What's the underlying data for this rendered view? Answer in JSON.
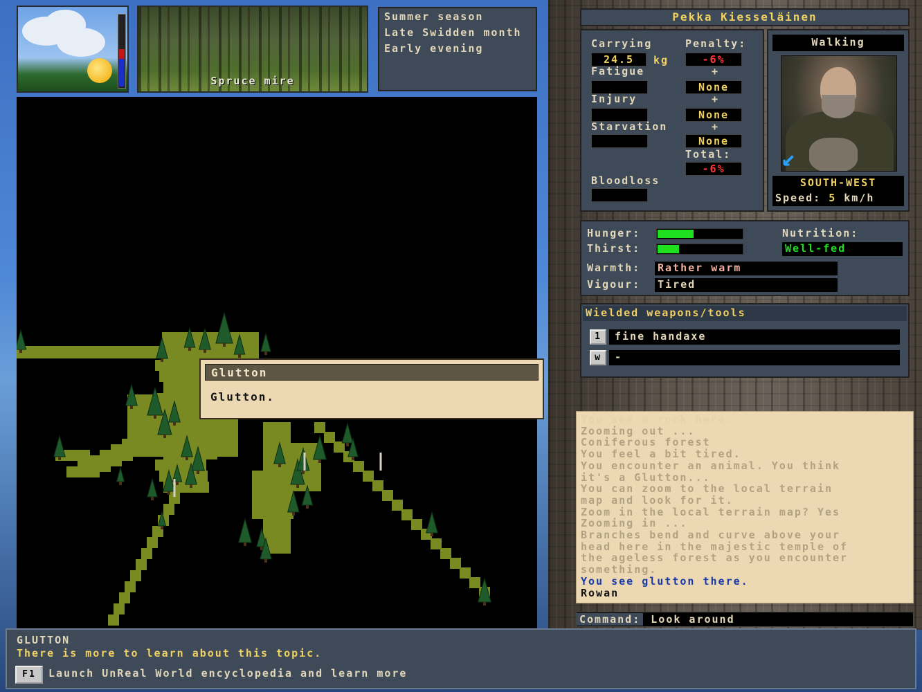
{
  "top": {
    "location_caption": "Spruce mire",
    "season": "Summer season",
    "month": "Late Swidden month",
    "time_of_day": "Early evening"
  },
  "popup": {
    "title": "Glutton",
    "body": "Glutton."
  },
  "character": {
    "name": "Pekka Kiesseläinen",
    "carrying_label": "Carrying",
    "carrying_value": "24.5",
    "carrying_unit": "kg",
    "penalty_label": "Penalty:",
    "penalty_value": "-6%",
    "fatigue_label": "Fatigue",
    "fatigue_penalty": "None",
    "injury_label": "Injury",
    "injury_penalty": "None",
    "starvation_label": "Starvation",
    "starvation_penalty": "None",
    "total_label": "Total:",
    "total_value": "-6%",
    "bloodloss_label": "Bloodloss",
    "plus": "+",
    "movement_mode": "Walking",
    "direction": "SOUTH-WEST",
    "speed_label": "Speed:",
    "speed_value": "5",
    "speed_unit": "km/h"
  },
  "needs": {
    "hunger_label": "Hunger:",
    "hunger_level": 0.42,
    "thirst_label": "Thirst:",
    "thirst_level": 0.25,
    "nutrition_label": "Nutrition:",
    "nutrition_value": "Well-fed",
    "warmth_label": "Warmth:",
    "warmth_value": "Rather warm",
    "vigour_label": "Vigour:",
    "vigour_value": "Tired"
  },
  "weapons": {
    "title": "Wielded weapons/tools",
    "slots": [
      {
        "key": "1",
        "item": "fine handaxe"
      },
      {
        "key": "w",
        "item": "-"
      }
    ]
  },
  "log": {
    "lines": [
      {
        "text": "You see a rock here.",
        "tone": "faint"
      },
      {
        "text": "Zooming out ...",
        "tone": "mid"
      },
      {
        "text": "Coniferous forest",
        "tone": "mid"
      },
      {
        "text": "You feel a bit tired.",
        "tone": "mid"
      },
      {
        "text": "You encounter an animal. You think",
        "tone": "mid"
      },
      {
        "text": "it's a Glutton...",
        "tone": "mid"
      },
      {
        "text": "You can zoom to the local terrain",
        "tone": "mid"
      },
      {
        "text": "map and look for it.",
        "tone": "mid"
      },
      {
        "text": "Zoom in the local terrain map? Yes",
        "tone": "mid"
      },
      {
        "text": "Zooming in ...",
        "tone": "mid"
      },
      {
        "text": "Branches bend and curve above your",
        "tone": "mid"
      },
      {
        "text": "head here in the majestic temple of",
        "tone": "mid"
      },
      {
        "text": "the ageless forest as you encounter",
        "tone": "mid"
      },
      {
        "text": "something.",
        "tone": "mid"
      },
      {
        "text": "You see glutton there.",
        "tone": "blue"
      },
      {
        "text": "Rowan",
        "tone": "dark"
      }
    ]
  },
  "command": {
    "label": "Command:",
    "value": "Look around"
  },
  "footer": {
    "topic": "GLUTTON",
    "hint": "There is more to learn about this topic.",
    "key": "F1",
    "action": "Launch UnReal World encyclopedia and learn more"
  },
  "colors": {
    "panel": "#3e4a58",
    "accent_yellow": "#f0d060",
    "text_light": "#e2d7b8",
    "penalty_red": "#ff3838",
    "gauge_green": "#1ee01e",
    "parchment": "#ecd9b3",
    "grass": "#7a8a22"
  }
}
